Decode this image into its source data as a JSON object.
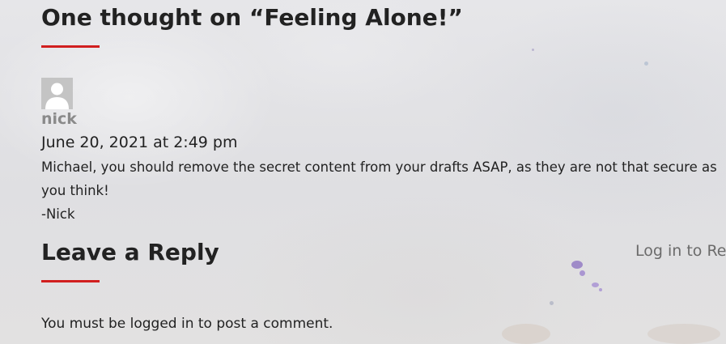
{
  "comments_section": {
    "title": "One thought on “Feeling Alone!”",
    "accent_color": "#d11f1f"
  },
  "comment": {
    "avatar_icon": "user-avatar-icon",
    "author": "nick",
    "date": "June 20, 2021 at 2:49 pm",
    "lines": [
      "Michael, you should remove the secret content from your drafts ASAP, as they are not that secure as",
      "you think!",
      "-Nick"
    ]
  },
  "reply_section": {
    "title": "Leave a Reply",
    "login_link": "Log in to Re",
    "notice": "You must be logged in to post a comment."
  }
}
